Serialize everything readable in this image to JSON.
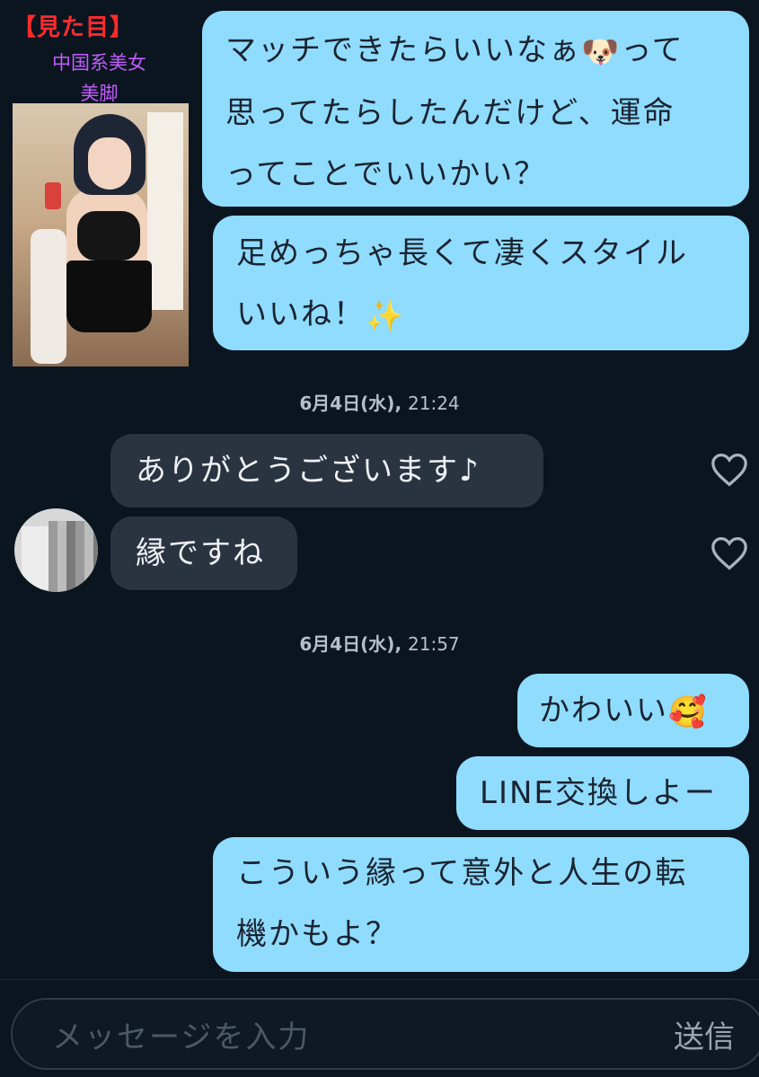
{
  "overlay": {
    "label": "【見た目】",
    "line1": "中国系美女",
    "line2": "美脚"
  },
  "messages": [
    {
      "dir": "out",
      "lines": [
        "マッチできたらいいなぁ",
        "思ってたらしたんだけど、運命",
        "ってことでいいかい？"
      ],
      "line1_suffix": "って",
      "emoji1": "dog-face"
    },
    {
      "dir": "out",
      "lines": [
        "足めっちゃ長くて凄くスタイル",
        "いいね！"
      ],
      "emoji": "sparkles"
    },
    {
      "dir": "in",
      "text": "ありがとうございます♪"
    },
    {
      "dir": "in",
      "text": "縁ですね"
    },
    {
      "dir": "out",
      "text": "かわいい",
      "emoji": "smiling-face-with-hearts"
    },
    {
      "dir": "out",
      "text": "LINE交換しよー"
    },
    {
      "dir": "out",
      "lines": [
        "こういう縁って意外と人生の転",
        "機かもよ？"
      ]
    }
  ],
  "timestamps": [
    {
      "date": "6月4日(水),",
      "time": "21:24"
    },
    {
      "date": "6月4日(水),",
      "time": "21:57"
    }
  ],
  "composer": {
    "placeholder": "メッセージを入力",
    "send_label": "送信"
  },
  "colors": {
    "background": "#0b1520",
    "outgoing_bubble": "#8fdcff",
    "incoming_bubble": "#2a3441",
    "overlay_label": "#ff2b2b",
    "overlay_text": "#c25cff"
  }
}
